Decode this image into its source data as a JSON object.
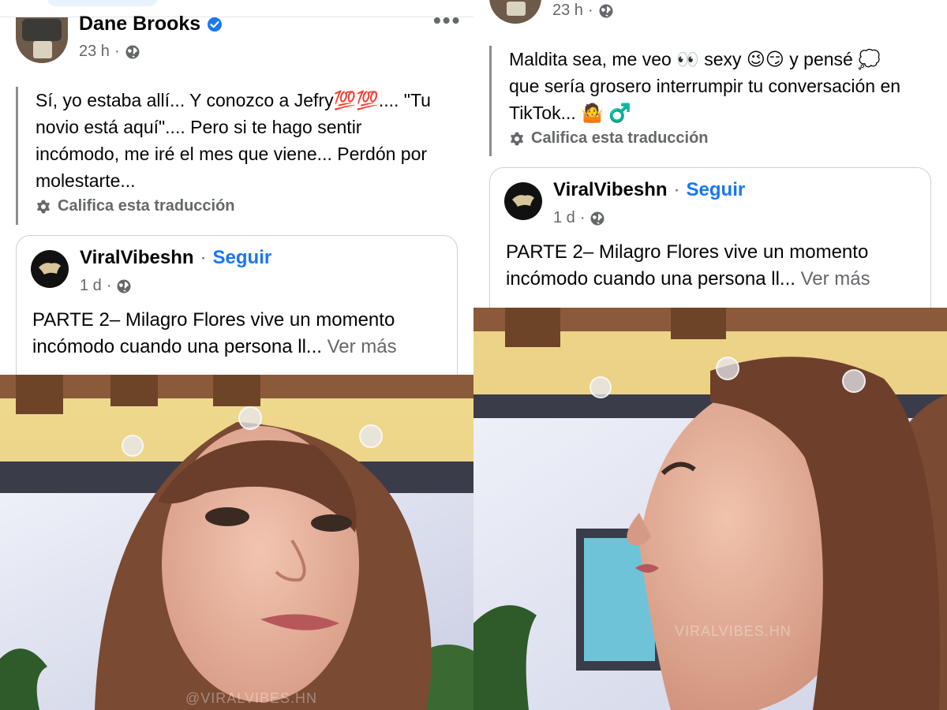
{
  "left": {
    "author": "Dane Brooks",
    "time": "23 h",
    "comment": "Sí, yo estaba allí... Y conozco a Jefry💯💯.... \"Tu novio está aquí\".... Pero si te hago sentir incómodo, me iré el mes que viene... Perdón por molestarte...",
    "rate_translation": "Califica esta traducción",
    "shared": {
      "page_name": "ViralVibeshn",
      "follow": "Seguir",
      "time": "1 d",
      "text": "PARTE 2– Milagro Flores vive un momento incómodo cuando una persona ll...",
      "see_more": "Ver más"
    },
    "watermark": "@VIRALVIBES.HN"
  },
  "right": {
    "time": "23 h",
    "comment": "Maldita sea, me veo 👀 sexy 😉😏 y pensé 💭 que sería grosero interrumpir tu conversación en TikTok... 🤷 ♂️",
    "rate_translation": "Califica esta traducción",
    "shared": {
      "page_name": "ViralVibeshn",
      "follow": "Seguir",
      "time": "1 d",
      "text": "PARTE 2– Milagro Flores vive un momento incómodo cuando una persona ll...",
      "see_more": "Ver más"
    },
    "watermark": "VIRALVIBES.HN"
  },
  "icons": {
    "verified": "verified-badge-icon",
    "globe": "globe-icon",
    "gear": "gear-icon",
    "more": "more-options-icon"
  },
  "colors": {
    "link_blue": "#1877f2",
    "meta_gray": "#65676b",
    "text": "#050505"
  }
}
